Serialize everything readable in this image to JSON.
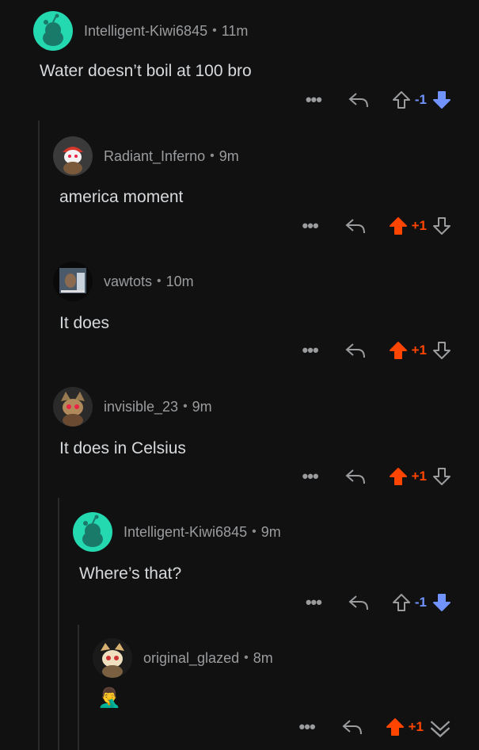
{
  "comments": [
    {
      "username": "Intelligent-Kiwi6845",
      "time": "11m",
      "text": "Water doesn’t boil at 100 bro",
      "score": "-1",
      "vote": "down"
    },
    {
      "username": "Radiant_Inferno",
      "time": "9m",
      "text": "america moment",
      "score": "+1",
      "vote": "up"
    },
    {
      "username": "vawtots",
      "time": "10m",
      "text": "It does",
      "score": "+1",
      "vote": "up"
    },
    {
      "username": "invisible_23",
      "time": "9m",
      "text": "It does in Celsius",
      "score": "+1",
      "vote": "up"
    },
    {
      "username": "Intelligent-Kiwi6845",
      "time": "9m",
      "text": "Where’s that?",
      "score": "-1",
      "vote": "down"
    },
    {
      "username": "original_glazed",
      "time": "8m",
      "text": "🤦‍♂️",
      "score": "+1",
      "vote": "up"
    }
  ],
  "separator": "•",
  "more_label": "•••",
  "colors": {
    "upvote": "#ff4500",
    "downvote": "#7193ff",
    "kiwi_avatar": "#24d8b0"
  }
}
